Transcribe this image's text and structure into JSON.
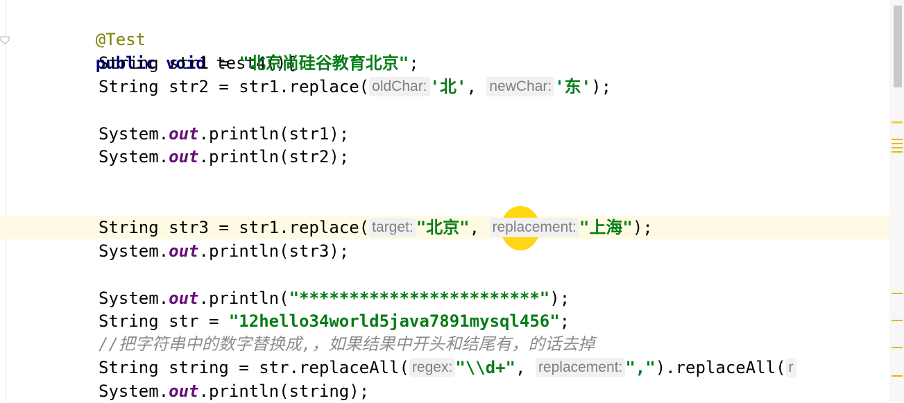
{
  "code": {
    "line_annotation": "@Test",
    "line_method": {
      "kw1": "public",
      "kw2": "void",
      "name": "test4(){"
    },
    "line_str1": {
      "decl": "String str1 = ",
      "value": "\"北京尚硅谷教育北京\"",
      "end": ";"
    },
    "line_str2": {
      "decl": "String str2 = str1.replace(",
      "hint1": "oldChar:",
      "arg1": "'北'",
      "sep": ", ",
      "hint2": "newChar:",
      "arg2": "'东'",
      "end": ");"
    },
    "line_print1": {
      "pre": "System.",
      "field": "out",
      "post": ".println(str1);"
    },
    "line_print2": {
      "pre": "System.",
      "field": "out",
      "post": ".println(str2);"
    },
    "line_str3": {
      "decl": "String str3 = str1.replace(",
      "hint1": "target:",
      "arg1": "\"北京\"",
      "sep": ", ",
      "hint2": "replacement:",
      "arg2": "\"上海\"",
      "end": ");"
    },
    "line_print3": {
      "pre": "System.",
      "field": "out",
      "post": ".println(str3);"
    },
    "line_print_stars": {
      "pre": "System.",
      "field": "out",
      "mid": ".println(",
      "value": "\"************************\"",
      "end": ");"
    },
    "line_str": {
      "decl": "String str = ",
      "value": "\"12hello34world5java7891mysql456\"",
      "end": ";"
    },
    "line_comment": "//把字符串中的数字替换成,，如果结果中开头和结尾有，的话去掉",
    "line_string": {
      "decl": "String string = str.replaceAll(",
      "hint1": "regex:",
      "arg1": "\"\\\\d+\"",
      "sep": ", ",
      "hint2": "replacement:",
      "arg2": "\",\"",
      "mid": ").replaceAll(",
      "hint3": "r"
    },
    "line_print_string": {
      "pre": "System.",
      "field": "out",
      "post": ".println(string);"
    }
  },
  "colors": {
    "annotation": "#808000",
    "keyword": "#000080",
    "string": "#067d17",
    "field": "#660e7a",
    "comment": "#8c8c8c",
    "current_line": "#fffae3",
    "cursor_highlight": "#ffd400"
  }
}
